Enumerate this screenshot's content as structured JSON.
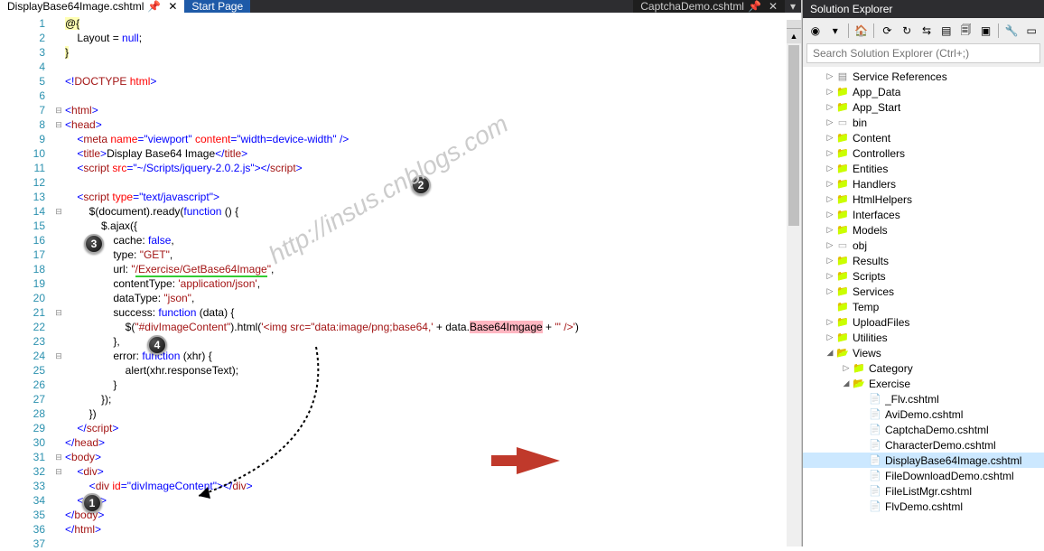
{
  "tabs": {
    "left_active": "DisplayBase64Image.cshtml",
    "mid": "Start Page",
    "right": "CaptchaDemo.cshtml"
  },
  "solution": {
    "title": "Solution Explorer",
    "search_placeholder": "Search Solution Explorer (Ctrl+;)"
  },
  "tree": [
    {
      "depth": 1,
      "exp": "▷",
      "icon": "ic-ref",
      "label": "Service References"
    },
    {
      "depth": 1,
      "exp": "▷",
      "icon": "ic-folder",
      "label": "App_Data"
    },
    {
      "depth": 1,
      "exp": "▷",
      "icon": "ic-folder",
      "label": "App_Start"
    },
    {
      "depth": 1,
      "exp": "▷",
      "icon": "ic-folder-dotted",
      "label": "bin"
    },
    {
      "depth": 1,
      "exp": "▷",
      "icon": "ic-folder",
      "label": "Content"
    },
    {
      "depth": 1,
      "exp": "▷",
      "icon": "ic-folder",
      "label": "Controllers"
    },
    {
      "depth": 1,
      "exp": "▷",
      "icon": "ic-folder",
      "label": "Entities"
    },
    {
      "depth": 1,
      "exp": "▷",
      "icon": "ic-folder",
      "label": "Handlers"
    },
    {
      "depth": 1,
      "exp": "▷",
      "icon": "ic-folder",
      "label": "HtmlHelpers"
    },
    {
      "depth": 1,
      "exp": "▷",
      "icon": "ic-folder",
      "label": "Interfaces"
    },
    {
      "depth": 1,
      "exp": "▷",
      "icon": "ic-folder",
      "label": "Models"
    },
    {
      "depth": 1,
      "exp": "▷",
      "icon": "ic-folder-dotted",
      "label": "obj"
    },
    {
      "depth": 1,
      "exp": "▷",
      "icon": "ic-folder",
      "label": "Results"
    },
    {
      "depth": 1,
      "exp": "▷",
      "icon": "ic-folder",
      "label": "Scripts"
    },
    {
      "depth": 1,
      "exp": "▷",
      "icon": "ic-folder",
      "label": "Services"
    },
    {
      "depth": 1,
      "exp": "",
      "icon": "ic-folder",
      "label": "Temp"
    },
    {
      "depth": 1,
      "exp": "▷",
      "icon": "ic-folder",
      "label": "UploadFiles"
    },
    {
      "depth": 1,
      "exp": "▷",
      "icon": "ic-folder",
      "label": "Utilities"
    },
    {
      "depth": 1,
      "exp": "◢",
      "icon": "ic-folder-open",
      "label": "Views"
    },
    {
      "depth": 2,
      "exp": "▷",
      "icon": "ic-folder",
      "label": "Category"
    },
    {
      "depth": 2,
      "exp": "◢",
      "icon": "ic-folder-open",
      "label": "Exercise"
    },
    {
      "depth": 3,
      "exp": "",
      "icon": "ic-file",
      "label": "_Flv.cshtml"
    },
    {
      "depth": 3,
      "exp": "",
      "icon": "ic-file",
      "label": "AviDemo.cshtml"
    },
    {
      "depth": 3,
      "exp": "",
      "icon": "ic-file",
      "label": "CaptchaDemo.cshtml"
    },
    {
      "depth": 3,
      "exp": "",
      "icon": "ic-file",
      "label": "CharacterDemo.cshtml"
    },
    {
      "depth": 3,
      "exp": "",
      "icon": "ic-file",
      "label": "DisplayBase64Image.cshtml",
      "selected": true
    },
    {
      "depth": 3,
      "exp": "",
      "icon": "ic-file",
      "label": "FileDownloadDemo.cshtml"
    },
    {
      "depth": 3,
      "exp": "",
      "icon": "ic-file",
      "label": "FileListMgr.cshtml"
    },
    {
      "depth": 3,
      "exp": "",
      "icon": "ic-file",
      "label": "FlvDemo.cshtml"
    }
  ],
  "lines": [
    1,
    2,
    3,
    4,
    5,
    6,
    7,
    8,
    9,
    10,
    11,
    12,
    13,
    14,
    15,
    16,
    17,
    18,
    19,
    20,
    21,
    22,
    23,
    24,
    25,
    26,
    27,
    28,
    29,
    30,
    31,
    32,
    33,
    34,
    35,
    36,
    37
  ],
  "watermark": "http://insus.cnblogs.com",
  "callouts": {
    "1": "1",
    "2": "2",
    "3": "3",
    "4": "4"
  }
}
